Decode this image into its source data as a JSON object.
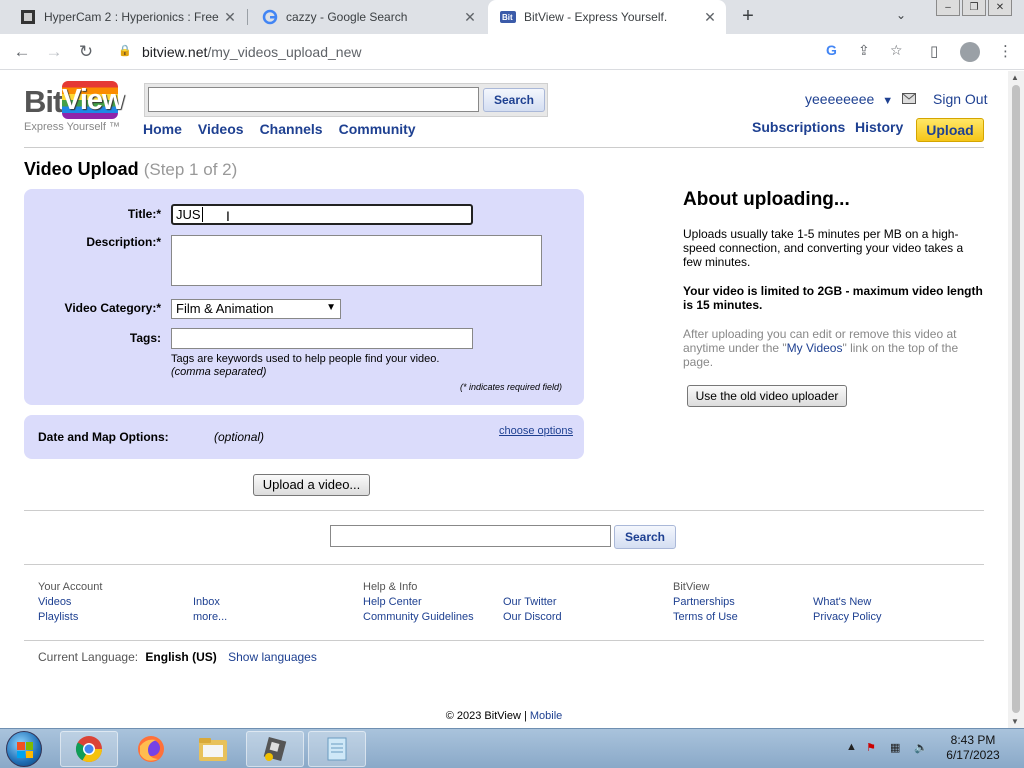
{
  "browser": {
    "tabs": [
      {
        "title": "HyperCam 2 : Hyperionics : Free",
        "icon": "hypercam-icon"
      },
      {
        "title": "cazzy - Google Search",
        "icon": "google-icon"
      },
      {
        "title": "BitView - Express Yourself.",
        "icon": "bitview-icon",
        "active": true
      }
    ],
    "url_host": "bitview.net",
    "url_path": "/my_videos_upload_new"
  },
  "header": {
    "logo_left": "Bit",
    "logo_right": "View",
    "tagline": "Express Yourself ™",
    "search_button": "Search",
    "nav": [
      "Home",
      "Videos",
      "Channels",
      "Community"
    ],
    "username": "yeeeeeeee",
    "sign_out": "Sign Out",
    "subscriptions": "Subscriptions",
    "history": "History",
    "upload": "Upload"
  },
  "upload": {
    "title": "Video Upload",
    "step": "(Step 1 of 2)",
    "title_label": "Title:*",
    "title_value": "JUS",
    "description_label": "Description:*",
    "category_label": "Video Category:*",
    "category_value": "Film & Animation",
    "tags_label": "Tags:",
    "tags_help": "Tags are keywords used to help people find your video.",
    "tags_help2": "(comma separated)",
    "required_note": "(* indicates required field)",
    "options_label": "Date and Map Options:",
    "options_optional": "(optional)",
    "choose_options": "choose options",
    "upload_button": "Upload a video..."
  },
  "about": {
    "heading": "About uploading...",
    "p1": "Uploads usually take 1-5 minutes per MB on a high-speed connection, and converting your video takes a few minutes.",
    "p2": "Your video is limited to 2GB - maximum video length is 15 minutes.",
    "p3_a": "After uploading you can edit or remove this video at anytime under the \"",
    "p3_link": "My Videos",
    "p3_b": "\" link on the top of the page.",
    "old_uploader": "Use the old video uploader"
  },
  "footer": {
    "search_button": "Search",
    "col1_head": "Your Account",
    "col1": [
      "Videos",
      "Playlists"
    ],
    "col1b": [
      "Inbox",
      "more..."
    ],
    "col2_head": "Help & Info",
    "col2": [
      "Help Center",
      "Community Guidelines"
    ],
    "col2b": [
      "Our Twitter",
      "Our Discord"
    ],
    "col3_head": "BitView",
    "col3": [
      "Partnerships",
      "Terms of Use"
    ],
    "col3b": [
      "What's New",
      "Privacy Policy"
    ],
    "lang_label": "Current Language:",
    "lang_value": "English (US)",
    "show_languages": "Show languages",
    "copyright": "© 2023 BitView |",
    "mobile": "Mobile"
  },
  "taskbar": {
    "time": "8:43 PM",
    "date": "6/17/2023"
  },
  "colors": {
    "link": "#1e4091",
    "form_bg": "#dbdcfb",
    "upload_btn": "#f5c518"
  }
}
